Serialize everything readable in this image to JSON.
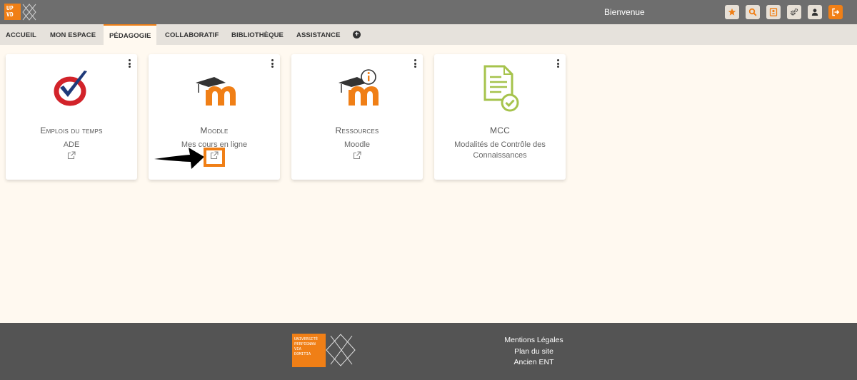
{
  "header": {
    "logo_lines": [
      "UP",
      "VD"
    ],
    "welcome": "Bienvenue",
    "buttons": [
      {
        "icon": "star-icon"
      },
      {
        "icon": "search-icon"
      },
      {
        "icon": "contact-icon"
      },
      {
        "icon": "settings-icon"
      },
      {
        "icon": "user-icon"
      },
      {
        "icon": "logout-icon"
      }
    ]
  },
  "nav": {
    "items": [
      "ACCUEIL",
      "MON ESPACE",
      "PÉDAGOGIE",
      "COLLABORATIF",
      "BIBLIOTHÈQUE",
      "ASSISTANCE"
    ],
    "active": "PÉDAGOGIE",
    "add_label": "+"
  },
  "cards": [
    {
      "title": "Emplois du temps",
      "subtitle": "ADE",
      "icon": "ade-checkmark-icon"
    },
    {
      "title": "Moodle",
      "subtitle": "Mes cours en ligne",
      "icon": "moodle-icon"
    },
    {
      "title": "Ressources",
      "subtitle": "Moodle",
      "icon": "moodle-info-icon"
    },
    {
      "title": "MCC",
      "subtitle": "Modalités de Contrôle des Connaissances",
      "icon": "document-check-icon"
    }
  ],
  "footer": {
    "logo_lines": [
      "UNIVERSITÉ",
      "PERPIGNAN",
      "VIA",
      "DOMITIA"
    ],
    "links": [
      "Mentions Légales",
      "Plan du site",
      "Ancien ENT"
    ]
  },
  "colors": {
    "accent": "#f07f16",
    "topbar": "#6e6e6e",
    "footer": "#545454",
    "background": "#fff9f0"
  }
}
